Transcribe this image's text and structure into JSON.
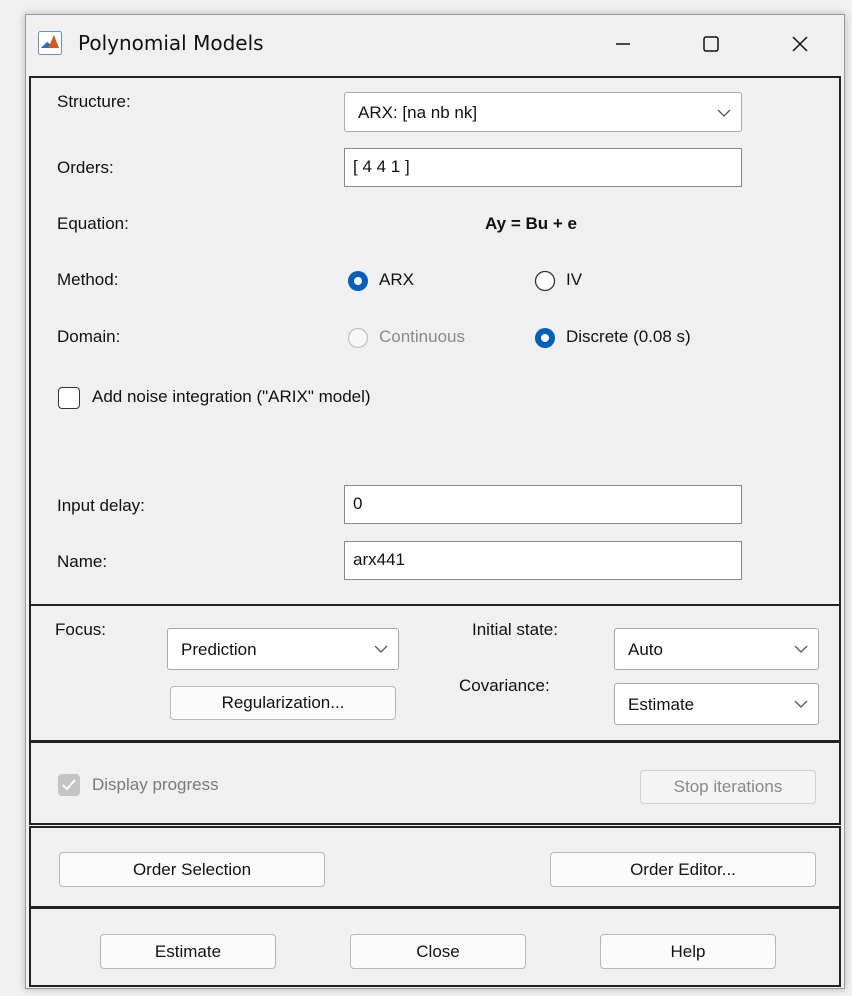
{
  "window": {
    "title": "Polynomial Models"
  },
  "model": {
    "structure_label": "Structure:",
    "structure_value": "ARX: [na nb nk]",
    "orders_label": "Orders:",
    "orders_value": "[ 4 4 1 ]",
    "equation_label": "Equation:",
    "equation_value": "Ay = Bu + e",
    "method_label": "Method:",
    "method_options": [
      "ARX",
      "IV"
    ],
    "method_selected": "ARX",
    "domain_label": "Domain:",
    "domain_options": [
      "Continuous",
      "Discrete (0.08 s)"
    ],
    "domain_selected": "Discrete (0.08 s)",
    "noise_integration_label": "Add noise integration (\"ARIX\" model)",
    "noise_integration_checked": false,
    "input_delay_label": "Input delay:",
    "input_delay_value": "0",
    "name_label": "Name:",
    "name_value": "arx441"
  },
  "options": {
    "focus_label": "Focus:",
    "focus_value": "Prediction",
    "regularization_label": "Regularization...",
    "initial_state_label": "Initial state:",
    "initial_state_value": "Auto",
    "covariance_label": "Covariance:",
    "covariance_value": "Estimate"
  },
  "progress": {
    "display_progress_label": "Display progress",
    "display_progress_checked": true,
    "stop_iterations_label": "Stop iterations"
  },
  "order_tools": {
    "order_selection_label": "Order Selection",
    "order_editor_label": "Order Editor..."
  },
  "actions": {
    "estimate_label": "Estimate",
    "close_label": "Close",
    "help_label": "Help"
  },
  "colors": {
    "accent": "#005fb8",
    "disabled": "#b9b9b9",
    "border": "#222222"
  },
  "icons": [
    "matlab-app-icon",
    "minimize-icon",
    "maximize-icon",
    "close-icon",
    "chevron-down-icon",
    "checkmark-icon"
  ]
}
